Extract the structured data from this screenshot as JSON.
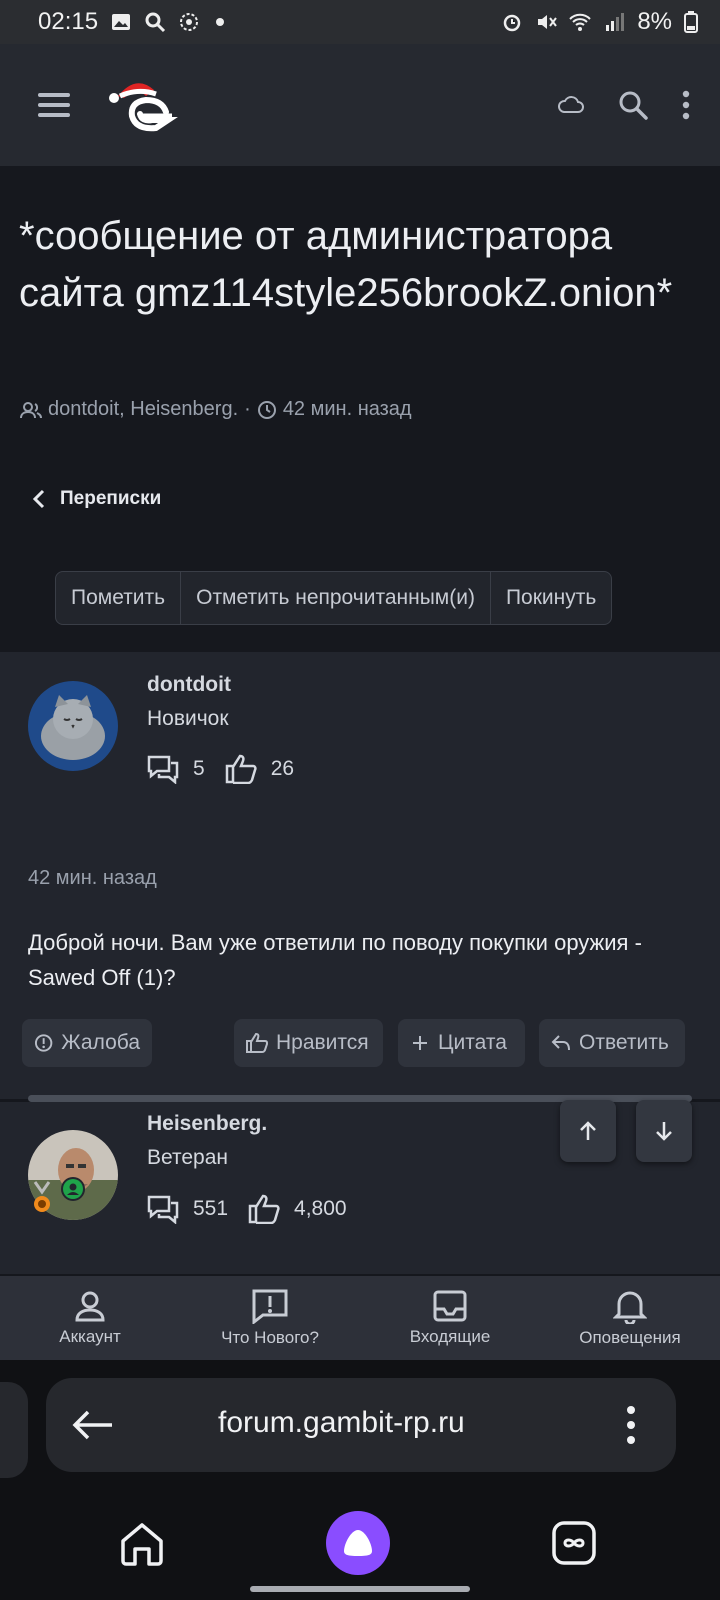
{
  "status_bar": {
    "time": "02:15",
    "battery": "8%"
  },
  "thread": {
    "title": "*сообщение от администратора сайта gmz114style256brookZ.onion*",
    "participants": "dontdoit, Heisenberg.",
    "separator": "·",
    "time": "42 мин. назад"
  },
  "back_link": {
    "label": "Переписки"
  },
  "actions": {
    "mark": "Пометить",
    "mark_unread": "Отметить непрочитанным(и)",
    "leave": "Покинуть"
  },
  "posts": [
    {
      "username": "dontdoit",
      "rank": "Новичок",
      "messages": "5",
      "likes": "26",
      "time": "42 мин. назад",
      "body": "Доброй ночи. Вам уже ответили по поводу покупки оружия - Sawed Off (1)?",
      "buttons": {
        "report": "Жалоба",
        "like": "Нравится",
        "quote": "Цитата",
        "reply": "Ответить"
      }
    },
    {
      "username": "Heisenberg.",
      "rank": "Ветеран",
      "messages": "551",
      "likes": "4,800"
    }
  ],
  "bottom_nav": [
    {
      "label": "Аккаунт",
      "icon": "user-icon"
    },
    {
      "label": "Что Нового?",
      "icon": "alert-message-icon"
    },
    {
      "label": "Входящие",
      "icon": "inbox-icon"
    },
    {
      "label": "Оповещения",
      "icon": "bell-icon"
    }
  ],
  "browser": {
    "url": "forum.gambit-rp.ru"
  },
  "colors": {
    "accent": "#8a4dff",
    "background": "#16181e",
    "post_background": "#22252d"
  }
}
